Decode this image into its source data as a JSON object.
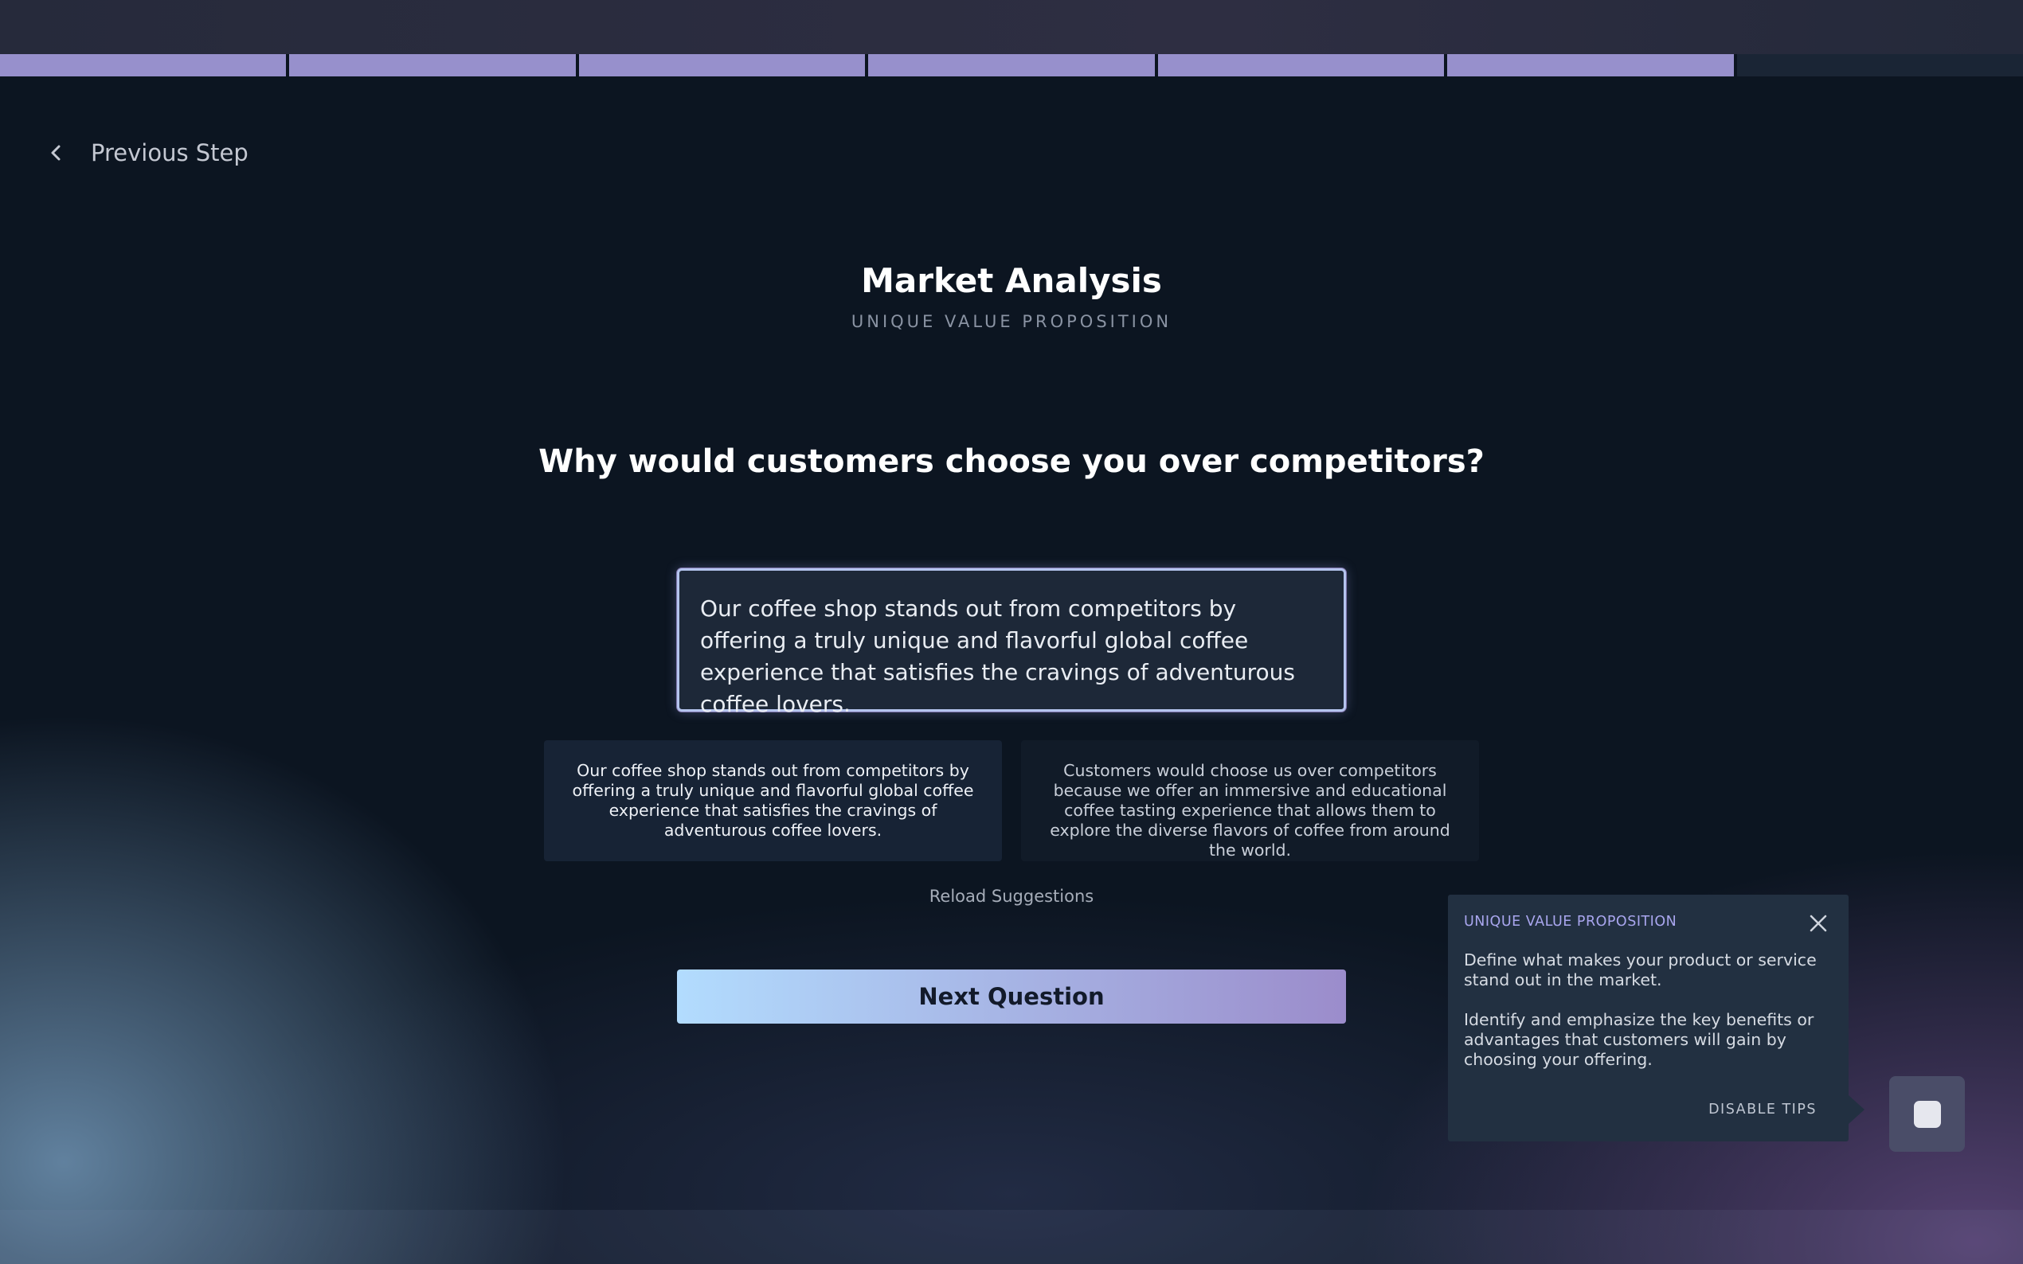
{
  "progress": {
    "segments_total": 7,
    "segments_completed": 6
  },
  "nav": {
    "previous_label": "Previous Step",
    "previous_icon": "chevron-left-icon"
  },
  "header": {
    "title": "Market Analysis",
    "subtitle": "UNIQUE VALUE PROPOSITION"
  },
  "question": {
    "text": "Why would customers choose you over competitors?"
  },
  "answer": {
    "value": "Our coffee shop stands out from competitors by offering a truly unique and flavorful global coffee experience that satisfies the cravings of adventurous coffee lovers."
  },
  "suggestions": [
    {
      "text": "Our coffee shop stands out from competitors by offering a truly unique and flavorful global coffee experience that satisfies the cravings of adventurous coffee lovers."
    },
    {
      "text": "Customers would choose us over competitors because we offer an immersive and educational coffee tasting experience that allows them to explore the diverse flavors of coffee from around the world."
    }
  ],
  "actions": {
    "reload_label": "Reload Suggestions",
    "next_label": "Next Question"
  },
  "tip": {
    "title": "UNIQUE VALUE PROPOSITION",
    "close_icon": "close-icon",
    "paragraph_1": "Define what makes your product or service stand out in the market.",
    "paragraph_2": "Identify and emphasize the key benefits or advantages that customers will gain by choosing your offering.",
    "disable_label": "DISABLE TIPS"
  },
  "colors": {
    "progress_done": "#9790cc",
    "progress_todo": "#1a2535",
    "accent_start": "#b2dcfe",
    "accent_end": "#9b8ccb",
    "tip_title": "#a9a6ee"
  }
}
